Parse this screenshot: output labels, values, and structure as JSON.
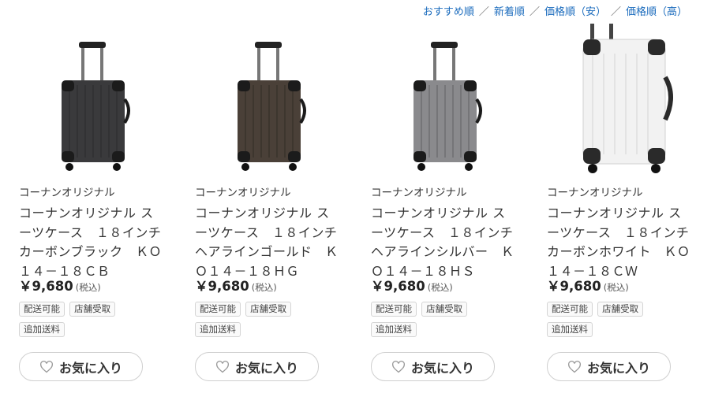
{
  "sort": {
    "options": [
      "おすすめ順",
      "新着順",
      "価格順（安）",
      "価格順（高）"
    ],
    "separator": "／"
  },
  "products": [
    {
      "brand": "コーナンオリジナル",
      "title": "コーナンオリジナル スーツケース　１８インチ　カーボンブラック　ＫＯ１４－１８ＣＢ",
      "price": "￥9,680",
      "tax": "(税込)",
      "tags": [
        "配送可能",
        "店舗受取",
        "追加送料"
      ],
      "favorite_label": "お気に入り",
      "image_icon": "suitcase-icon",
      "color": "#3a3a3c"
    },
    {
      "brand": "コーナンオリジナル",
      "title": "コーナンオリジナル スーツケース　１８インチ　ヘアラインゴールド　ＫＯ１４－１８ＨＧ",
      "price": "￥9,680",
      "tax": "(税込)",
      "tags": [
        "配送可能",
        "店舗受取",
        "追加送料"
      ],
      "favorite_label": "お気に入り",
      "image_icon": "suitcase-icon",
      "color": "#4a4038"
    },
    {
      "brand": "コーナンオリジナル",
      "title": "コーナンオリジナル スーツケース　１８インチ　ヘアラインシルバー　ＫＯ１４－１８ＨＳ",
      "price": "￥9,680",
      "tax": "(税込)",
      "tags": [
        "配送可能",
        "店舗受取",
        "追加送料"
      ],
      "favorite_label": "お気に入り",
      "image_icon": "suitcase-icon",
      "color": "#8a8a8d"
    },
    {
      "brand": "コーナンオリジナル",
      "title": "コーナンオリジナル スーツケース　１８インチ　カーボンホワイト　ＫＯ１４－１８ＣＷ",
      "price": "￥9,680",
      "tax": "(税込)",
      "tags": [
        "配送可能",
        "店舗受取",
        "追加送料"
      ],
      "favorite_label": "お気に入り",
      "image_icon": "suitcase-icon",
      "color": "#f2f2f2"
    }
  ]
}
